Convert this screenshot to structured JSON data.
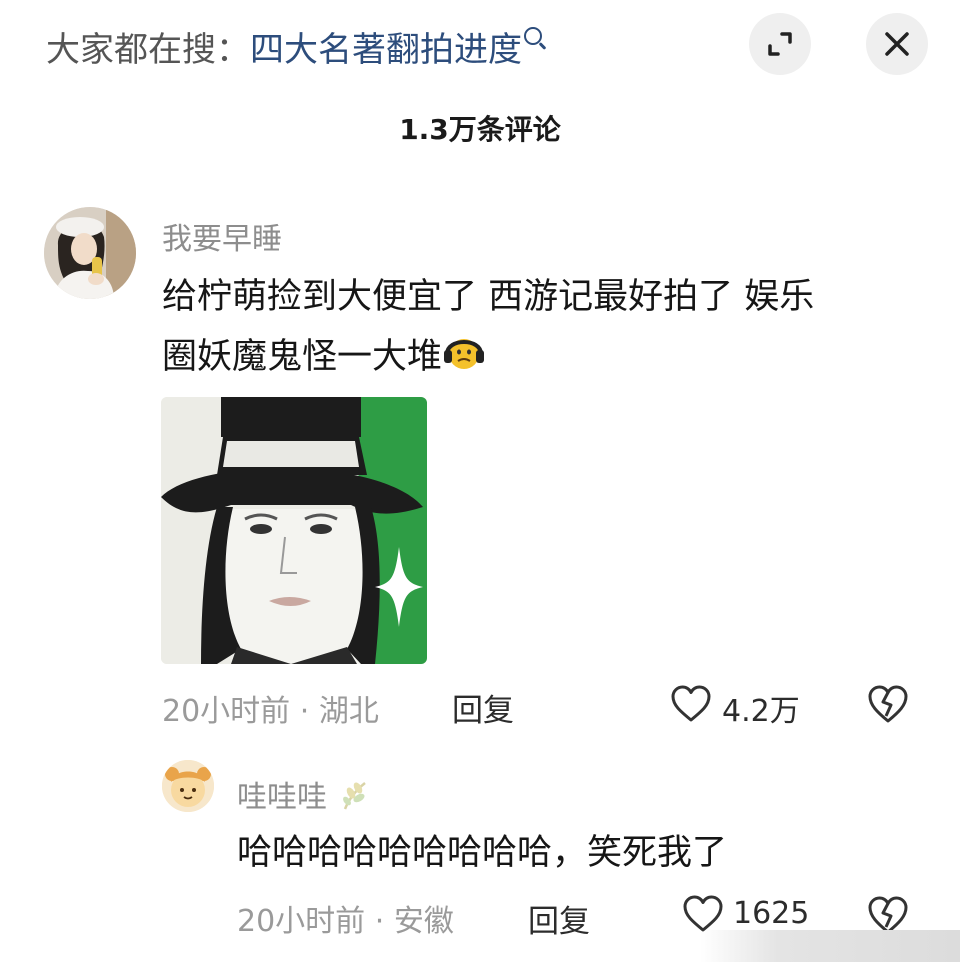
{
  "header": {
    "search_prefix": "大家都在搜：",
    "search_term": "四大名著翻拍进度"
  },
  "comments_title": "1.3万条评论",
  "comments": [
    {
      "username": "我要早睡",
      "text_line1": "给柠萌捡到大便宜了 西游记最好拍了 娱乐",
      "text_line2": "圈妖魔鬼怪一大堆",
      "time": "20小时前",
      "separator": "·",
      "location": "湖北",
      "reply_label": "回复",
      "like_count": "4.2万"
    },
    {
      "username": "哇哇哇",
      "text": "哈哈哈哈哈哈哈哈哈，笑死我了",
      "time": "20小时前",
      "separator": "·",
      "location": "安徽",
      "reply_label": "回复",
      "like_count": "1625"
    }
  ],
  "icons": {
    "expand": "expand-icon",
    "close": "close-icon",
    "like": "heart-icon",
    "dislike": "broken-heart-icon",
    "emoji": "headphones-face-emoji",
    "badge": "wheat-badge-icon"
  },
  "colors": {
    "search_term": "#2d4d7c",
    "meta_text": "#9a9a9a",
    "button_bg": "#efefef"
  }
}
